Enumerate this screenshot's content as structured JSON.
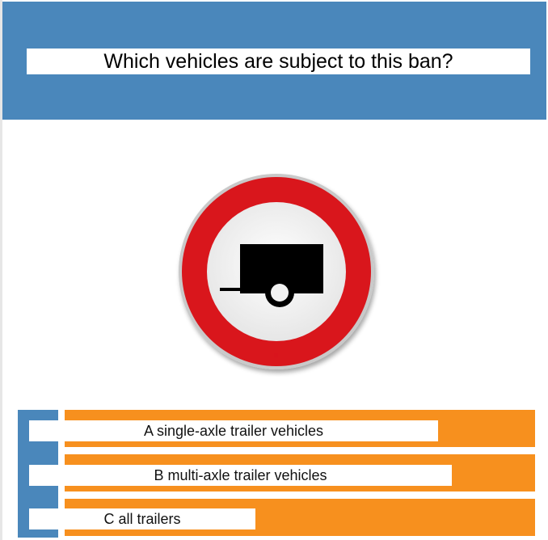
{
  "question": {
    "text": "Which vehicles are subject to this ban?"
  },
  "sign": {
    "icon": "no-trailers-sign-icon",
    "colors": {
      "border": "#d9141c",
      "face": "#f2f2f2",
      "symbol": "#000000"
    }
  },
  "answers": [
    {
      "label": "A single-axle trailer vehicles"
    },
    {
      "label": "B multi-axle trailer vehicles"
    },
    {
      "label": "C all trailers"
    }
  ],
  "colors": {
    "header": "#4a87bb",
    "answer_bar": "#f7901e"
  }
}
